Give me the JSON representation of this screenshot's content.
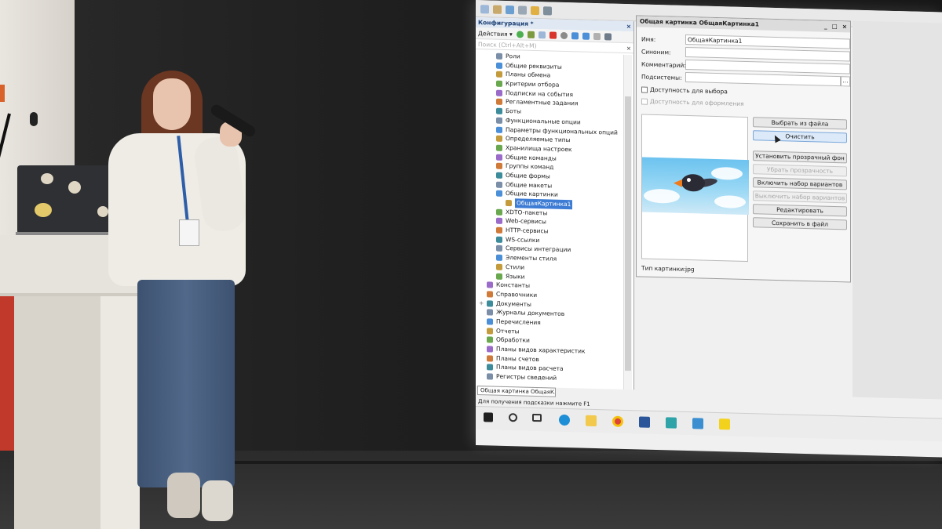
{
  "screen": {
    "config_panel": {
      "title": "Конфигурация *",
      "actions_label": "Действия ▾",
      "search_placeholder": "Поиск (Ctrl+Alt+M)",
      "tree": [
        {
          "label": "Роли",
          "level": 1
        },
        {
          "label": "Общие реквизиты",
          "level": 1
        },
        {
          "label": "Планы обмена",
          "level": 1
        },
        {
          "label": "Критерии отбора",
          "level": 1
        },
        {
          "label": "Подписки на события",
          "level": 1
        },
        {
          "label": "Регламентные задания",
          "level": 1
        },
        {
          "label": "Боты",
          "level": 1
        },
        {
          "label": "Функциональные опции",
          "level": 1
        },
        {
          "label": "Параметры функциональных опций",
          "level": 1
        },
        {
          "label": "Определяемые типы",
          "level": 1
        },
        {
          "label": "Хранилища настроек",
          "level": 1
        },
        {
          "label": "Общие команды",
          "level": 1
        },
        {
          "label": "Группы команд",
          "level": 1
        },
        {
          "label": "Общие формы",
          "level": 1
        },
        {
          "label": "Общие макеты",
          "level": 1
        },
        {
          "label": "Общие картинки",
          "level": 1
        },
        {
          "label": "ОбщаяКартинка1",
          "level": 2,
          "selected": true
        },
        {
          "label": "XDTO-пакеты",
          "level": 1
        },
        {
          "label": "Web-сервисы",
          "level": 1
        },
        {
          "label": "HTTP-сервисы",
          "level": 1
        },
        {
          "label": "WS-ссылки",
          "level": 1
        },
        {
          "label": "Сервисы интеграции",
          "level": 1
        },
        {
          "label": "Элементы стиля",
          "level": 1
        },
        {
          "label": "Стили",
          "level": 1
        },
        {
          "label": "Языки",
          "level": 1
        },
        {
          "label": "Константы",
          "level": 0
        },
        {
          "label": "Справочники",
          "level": 0
        },
        {
          "label": "Документы",
          "level": 0
        },
        {
          "label": "Журналы документов",
          "level": 0
        },
        {
          "label": "Перечисления",
          "level": 0
        },
        {
          "label": "Отчеты",
          "level": 0
        },
        {
          "label": "Обработки",
          "level": 0
        },
        {
          "label": "Планы видов характеристик",
          "level": 0
        },
        {
          "label": "Планы счетов",
          "level": 0
        },
        {
          "label": "Планы видов расчета",
          "level": 0
        },
        {
          "label": "Регистры сведений",
          "level": 0
        }
      ]
    },
    "bottom_tab": "Общая картинка ОбщаяК...",
    "status_text": "Для получения подсказки нажмите F1",
    "picture_window": {
      "title": "Общая картинка ОбщаяКартинка1",
      "fields": {
        "name_label": "Имя:",
        "name_value": "ОбщаяКартинка1",
        "synonym_label": "Синоним:",
        "comment_label": "Комментарий:",
        "subsystems_label": "Подсистемы:",
        "subsystems_button": "..."
      },
      "checkbox_select": "Доступность для выбора",
      "checkbox_design": "Доступность для оформления",
      "buttons": {
        "choose_file": "Выбрать из файла",
        "clear": "Очистить",
        "set_transparent": "Установить прозрачный фон",
        "remove_transparent": "Убрать прозрачность",
        "enable_variants": "Включить набор вариантов",
        "disable_variants": "Выключить набор вариантов",
        "edit": "Редактировать",
        "save_to_file": "Сохранить в файл"
      },
      "type_label": "Тип картинки:",
      "type_value": "jpg"
    },
    "window_controls": {
      "close": "×",
      "minimize": "_",
      "maximize": "□"
    }
  },
  "colors": {
    "selection": "#3d7cd4",
    "title_accent": "#1c3f73",
    "beak": "#f07a1a",
    "sky": "#6cc3ef"
  }
}
